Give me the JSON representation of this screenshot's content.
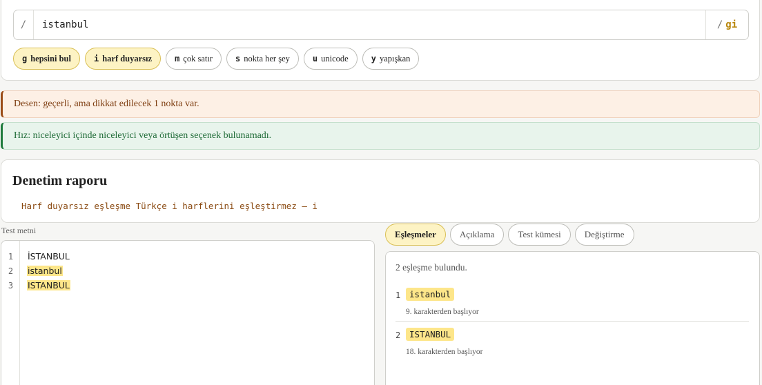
{
  "pattern": {
    "open_delim": "/",
    "value": "istanbul",
    "close_delim": "/",
    "flags": "gi"
  },
  "flag_chips": [
    {
      "key": "g",
      "label": "hepsini bul",
      "active": true
    },
    {
      "key": "i",
      "label": "harf duyarsız",
      "active": true
    },
    {
      "key": "m",
      "label": "çok satır",
      "active": false
    },
    {
      "key": "s",
      "label": "nokta her şey",
      "active": false
    },
    {
      "key": "u",
      "label": "unicode",
      "active": false
    },
    {
      "key": "y",
      "label": "yapışkan",
      "active": false
    }
  ],
  "alerts": {
    "pattern_status": "Desen: geçerli, ama dikkat edilecek 1 nokta var.",
    "speed_status": "Hız: niceleyici içinde niceleyici veya örtüşen seçenek bulunamadı."
  },
  "report": {
    "title": "Denetim raporu",
    "issue": "Harf duyarsız eşleşme Türkçe i harflerini eşleştirmez — i"
  },
  "test": {
    "label": "Test metni",
    "lines": [
      {
        "num": "1",
        "text": "İSTANBUL",
        "match": false
      },
      {
        "num": "2",
        "text": "istanbul",
        "match": true
      },
      {
        "num": "3",
        "text": "ISTANBUL",
        "match": true
      }
    ]
  },
  "tabs": [
    "Eşleşmeler",
    "Açıklama",
    "Test kümesi",
    "Değiştirme"
  ],
  "results": {
    "summary": "2 eşleşme bulundu.",
    "matches": [
      {
        "num": "1",
        "value": "istanbul",
        "position": "9. karakterden başlıyor"
      },
      {
        "num": "2",
        "value": "ISTANBUL",
        "position": "18. karakterden başlıyor"
      }
    ]
  },
  "colors": {
    "highlight": "#fde68a",
    "chip_active": "#fdf3c4",
    "flags_accent": "#b8860b",
    "warning": "#9a4b16",
    "success": "#1e7a3c"
  }
}
